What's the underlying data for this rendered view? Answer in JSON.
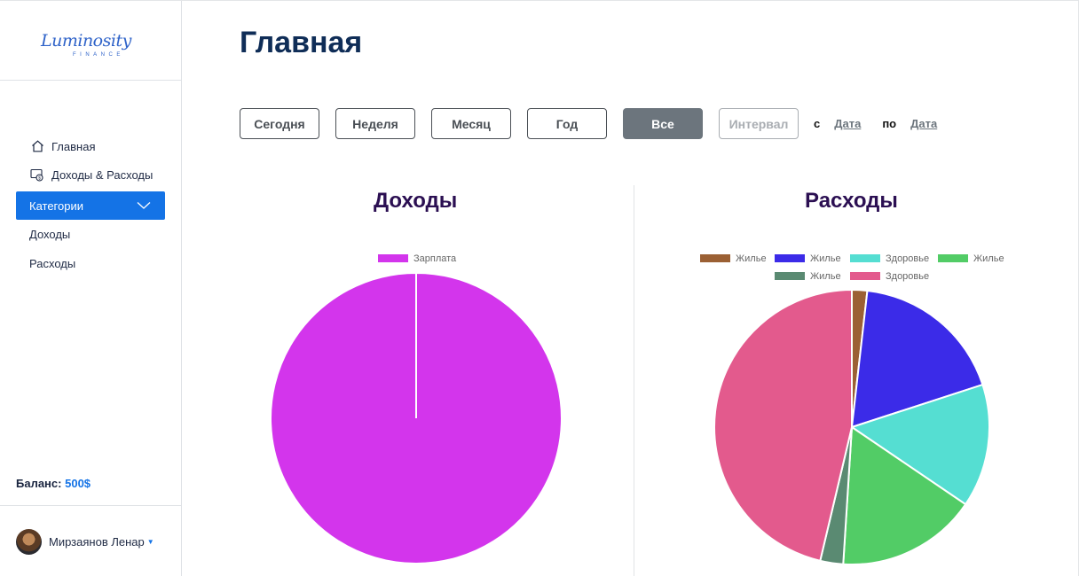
{
  "sidebar": {
    "logo": {
      "script": "Luminosity",
      "sub": "FINANCE"
    },
    "nav": [
      {
        "label": "Главная",
        "icon": "home-icon"
      },
      {
        "label": "Доходы & Расходы",
        "icon": "wallet-icon"
      }
    ],
    "categories": {
      "label": "Категории",
      "icon": "chevron-down-icon"
    },
    "sub_items": [
      {
        "label": "Доходы"
      },
      {
        "label": "Расходы"
      }
    ],
    "balance": {
      "label": "Баланс:",
      "amount": "500$"
    },
    "user": {
      "name": "Мирзаянов Ленар"
    }
  },
  "main": {
    "title": "Главная",
    "filters": [
      {
        "label": "Сегодня",
        "state": "default"
      },
      {
        "label": "Неделя",
        "state": "default"
      },
      {
        "label": "Месяц",
        "state": "default"
      },
      {
        "label": "Год",
        "state": "default"
      },
      {
        "label": "Все",
        "state": "active"
      },
      {
        "label": "Интервал",
        "state": "disabled"
      }
    ],
    "range": {
      "from_label": "с",
      "from_value": "Дата",
      "to_label": "по",
      "to_value": "Дата"
    }
  },
  "colors": {
    "accent": "#1473e6",
    "title": "#0f2d57",
    "chart_title": "#2b0f52"
  },
  "chart_data": [
    {
      "type": "pie",
      "title": "Доходы",
      "legend_position": "top",
      "categories": [
        "Зарплата"
      ],
      "values": [
        100
      ],
      "colors": [
        "#d335ec"
      ]
    },
    {
      "type": "pie",
      "title": "Расходы",
      "legend_position": "top",
      "categories": [
        "Жилье",
        "Жилье",
        "Здоровье",
        "Жилье",
        "Жилье",
        "Здоровье"
      ],
      "values": [
        1.8,
        18.2,
        14.5,
        16.5,
        2.7,
        46.3
      ],
      "colors": [
        "#9b6034",
        "#3b2be8",
        "#55ded2",
        "#52cc66",
        "#5a8a72",
        "#e35a8d"
      ]
    }
  ]
}
